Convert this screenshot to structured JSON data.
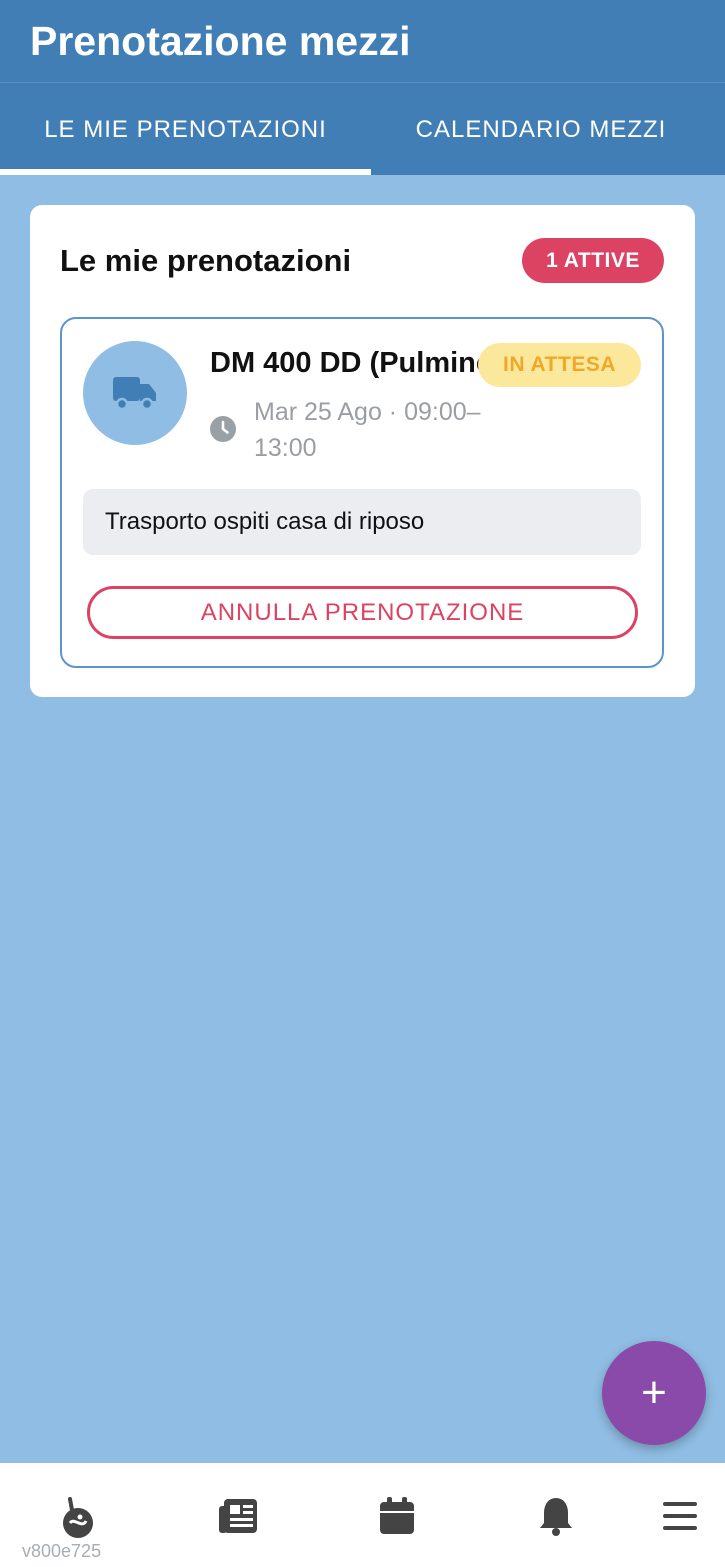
{
  "header": {
    "title": "Prenotazione mezzi"
  },
  "tabs": [
    {
      "label": "LE MIE PRENOTAZIONI",
      "active": true
    },
    {
      "label": "CALENDARIO MEZZI",
      "active": false
    }
  ],
  "panel": {
    "title": "Le mie prenotazioni",
    "active_badge": "1 ATTIVE",
    "bookings": [
      {
        "vehicle": "DM 400 DD (Pulmino)",
        "status": "IN ATTESA",
        "time_line1": "Mar 25 Ago · 09:00–",
        "time_line2": "13:00",
        "note": "Trasporto ospiti casa di riposo",
        "cancel_label": "ANNULLA PRENOTAZIONE",
        "icon": "truck-icon"
      }
    ]
  },
  "fab": {
    "label": "+"
  },
  "bottom_nav": {
    "items": [
      "home-icon",
      "news-icon",
      "calendar-icon",
      "bell-icon",
      "menu-icon"
    ],
    "version": "v800e725"
  },
  "colors": {
    "primary": "#427eb6",
    "background": "#8fbde3",
    "danger": "#dc4363",
    "pending_bg": "#fce89a",
    "pending_text": "#f0a82a",
    "fab": "#8a4aaa"
  }
}
